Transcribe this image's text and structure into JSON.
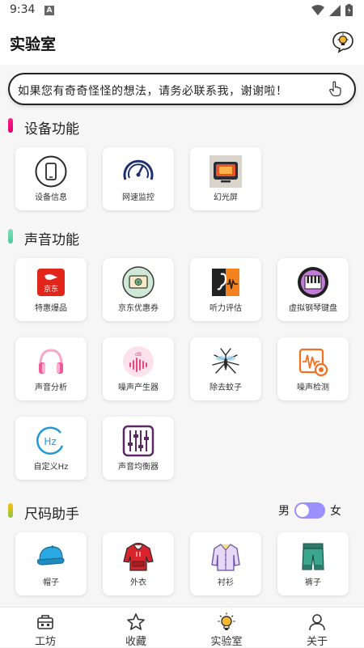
{
  "status_bar": {
    "time": "9:34",
    "notif_icon": "A"
  },
  "app_bar": {
    "title": "实验室",
    "action_icon": "lightbulb-chat-icon"
  },
  "notice": {
    "text": "如果您有奇奇怪怪的想法，请务必联系我，谢谢啦！"
  },
  "sections": {
    "device": {
      "title": "设备功能",
      "accent": "#e91e8c",
      "items": [
        {
          "label": "设备信息",
          "icon": "phone-icon"
        },
        {
          "label": "网速监控",
          "icon": "speedometer-icon"
        },
        {
          "label": "幻光屏",
          "icon": "tv-icon"
        }
      ]
    },
    "sound": {
      "title": "声音功能",
      "accent": "#5cc9a0",
      "items": [
        {
          "label": "特惠爆品",
          "icon": "jd-icon"
        },
        {
          "label": "京东优惠券",
          "icon": "coupon-icon"
        },
        {
          "label": "听力评估",
          "icon": "hearing-icon"
        },
        {
          "label": "虚拟钢琴键盘",
          "icon": "piano-icon"
        },
        {
          "label": "声音分析",
          "icon": "headphones-icon"
        },
        {
          "label": "噪声产生器",
          "icon": "db-wave-icon"
        },
        {
          "label": "除去蚊子",
          "icon": "mosquito-icon"
        },
        {
          "label": "噪声检测",
          "icon": "noise-meter-icon"
        },
        {
          "label": "自定义Hz",
          "icon": "hz-icon"
        },
        {
          "label": "声音均衡器",
          "icon": "equalizer-icon"
        }
      ]
    },
    "size": {
      "title": "尺码助手",
      "accent": "#f2a800",
      "toggle": {
        "left": "男",
        "right": "女",
        "selected": "男"
      },
      "items": [
        {
          "label": "帽子",
          "icon": "cap-icon"
        },
        {
          "label": "外衣",
          "icon": "hoodie-icon"
        },
        {
          "label": "衬衫",
          "icon": "shirt-icon"
        },
        {
          "label": "裤子",
          "icon": "pants-icon"
        }
      ]
    }
  },
  "bottom_nav": [
    {
      "label": "工坊",
      "icon": "toolbox-icon",
      "active": false
    },
    {
      "label": "收藏",
      "icon": "star-icon",
      "active": false
    },
    {
      "label": "实验室",
      "icon": "lab-bulb-icon",
      "active": true
    },
    {
      "label": "关于",
      "icon": "person-icon",
      "active": false
    }
  ]
}
